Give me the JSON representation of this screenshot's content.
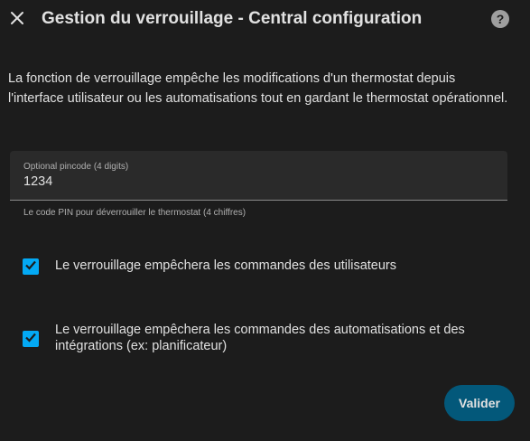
{
  "dialog": {
    "title": "Gestion du verrouillage - Central configuration",
    "close_icon": "close-icon",
    "help_icon": "help-circle-icon",
    "description": "La fonction de verrouillage empêche les modifications d'un thermostat depuis l'interface utilisateur ou les automatisations tout en gardant le thermostat opérationnel."
  },
  "pincode_field": {
    "label": "Optional pincode (4 digits)",
    "value": "1234",
    "helper": "Le code PIN pour déverrouiller le thermostat (4 chiffres)"
  },
  "checkboxes": [
    {
      "label": "Le verrouillage empêchera les commandes des utilisateurs",
      "checked": true
    },
    {
      "label": "Le verrouillage empêchera les commandes des automatisations et des intégrations (ex: planificateur)",
      "checked": true
    }
  ],
  "actions": {
    "validate_label": "Valider"
  },
  "colors": {
    "background": "#1c1c1c",
    "field_background": "#2a2a2a",
    "checkbox_accent": "#03a9f4",
    "button_background": "#03587a",
    "text": "#e1e1e1"
  }
}
